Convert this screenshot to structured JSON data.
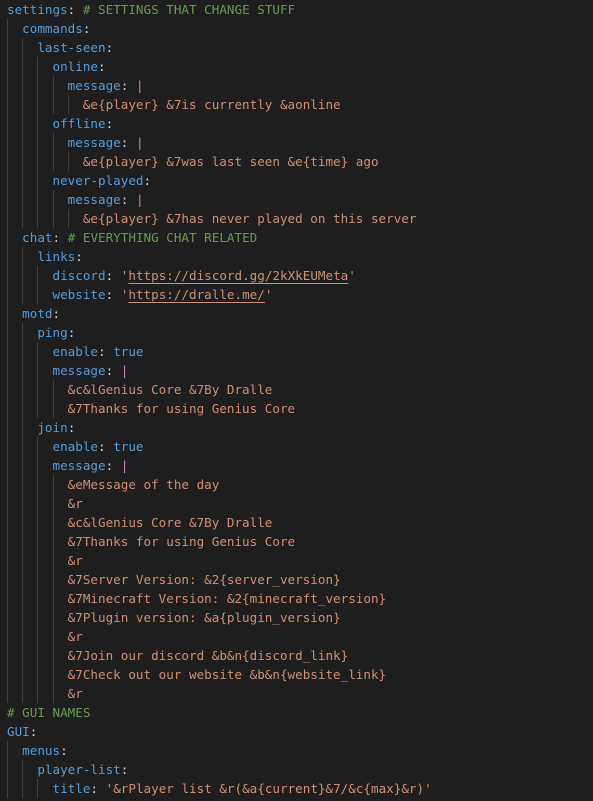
{
  "editor": {
    "language": "yaml",
    "colors": {
      "background": "#1e1e1e",
      "key": "#569cd6",
      "string": "#ce9178",
      "comment": "#6a9955",
      "block_indicator": "#c586c0"
    },
    "lines": [
      {
        "indent": 0,
        "key": "settings",
        "comment": "# SETTINGS THAT CHANGE STUFF"
      },
      {
        "indent": 1,
        "key": "commands"
      },
      {
        "indent": 2,
        "key": "last-seen"
      },
      {
        "indent": 3,
        "key": "online"
      },
      {
        "indent": 4,
        "key": "message",
        "block": "|"
      },
      {
        "indent": 5,
        "text": "&e{player} &7is currently &aonline"
      },
      {
        "indent": 3,
        "key": "offline"
      },
      {
        "indent": 4,
        "key": "message",
        "block": "|"
      },
      {
        "indent": 5,
        "text": "&e{player} &7was last seen &e{time} ago"
      },
      {
        "indent": 3,
        "key": "never-played"
      },
      {
        "indent": 4,
        "key": "message",
        "block": "|"
      },
      {
        "indent": 5,
        "text": "&e{player} &7has never played on this server"
      },
      {
        "indent": 1,
        "key": "chat",
        "comment": "# EVERYTHING CHAT RELATED"
      },
      {
        "indent": 2,
        "key": "links"
      },
      {
        "indent": 3,
        "key": "discord",
        "quoted": "https://discord.gg/2kXkEUMeta",
        "link": true
      },
      {
        "indent": 3,
        "key": "website",
        "quoted": "https://dralle.me/",
        "link": true
      },
      {
        "indent": 1,
        "key": "motd"
      },
      {
        "indent": 2,
        "key": "ping"
      },
      {
        "indent": 3,
        "key": "enable",
        "bool": "true"
      },
      {
        "indent": 3,
        "key": "message",
        "block": "|"
      },
      {
        "indent": 4,
        "text": "&c&lGenius Core &7By Dralle"
      },
      {
        "indent": 4,
        "text": "&7Thanks for using Genius Core"
      },
      {
        "indent": 2,
        "key": "join"
      },
      {
        "indent": 3,
        "key": "enable",
        "bool": "true"
      },
      {
        "indent": 3,
        "key": "message",
        "block": "|"
      },
      {
        "indent": 4,
        "text": "&eMessage of the day"
      },
      {
        "indent": 4,
        "text": "&r"
      },
      {
        "indent": 4,
        "text": "&c&lGenius Core &7By Dralle"
      },
      {
        "indent": 4,
        "text": "&7Thanks for using Genius Core"
      },
      {
        "indent": 4,
        "text": "&r"
      },
      {
        "indent": 4,
        "text": "&7Server Version: &2{server_version}"
      },
      {
        "indent": 4,
        "text": "&7Minecraft Version: &2{minecraft_version}"
      },
      {
        "indent": 4,
        "text": "&7Plugin version: &a{plugin_version}"
      },
      {
        "indent": 4,
        "text": "&r"
      },
      {
        "indent": 4,
        "text": "&7Join our discord &b&n{discord_link}"
      },
      {
        "indent": 4,
        "text": "&7Check out our website &b&n{website_link}"
      },
      {
        "indent": 4,
        "text": "&r"
      },
      {
        "indent": 0,
        "comment": "# GUI NAMES"
      },
      {
        "indent": 0,
        "key": "GUI"
      },
      {
        "indent": 1,
        "key": "menus"
      },
      {
        "indent": 2,
        "key": "player-list"
      },
      {
        "indent": 3,
        "key": "title",
        "quoted": "&rPlayer list &r(&a{current}&7/&c{max}&r)"
      }
    ]
  }
}
